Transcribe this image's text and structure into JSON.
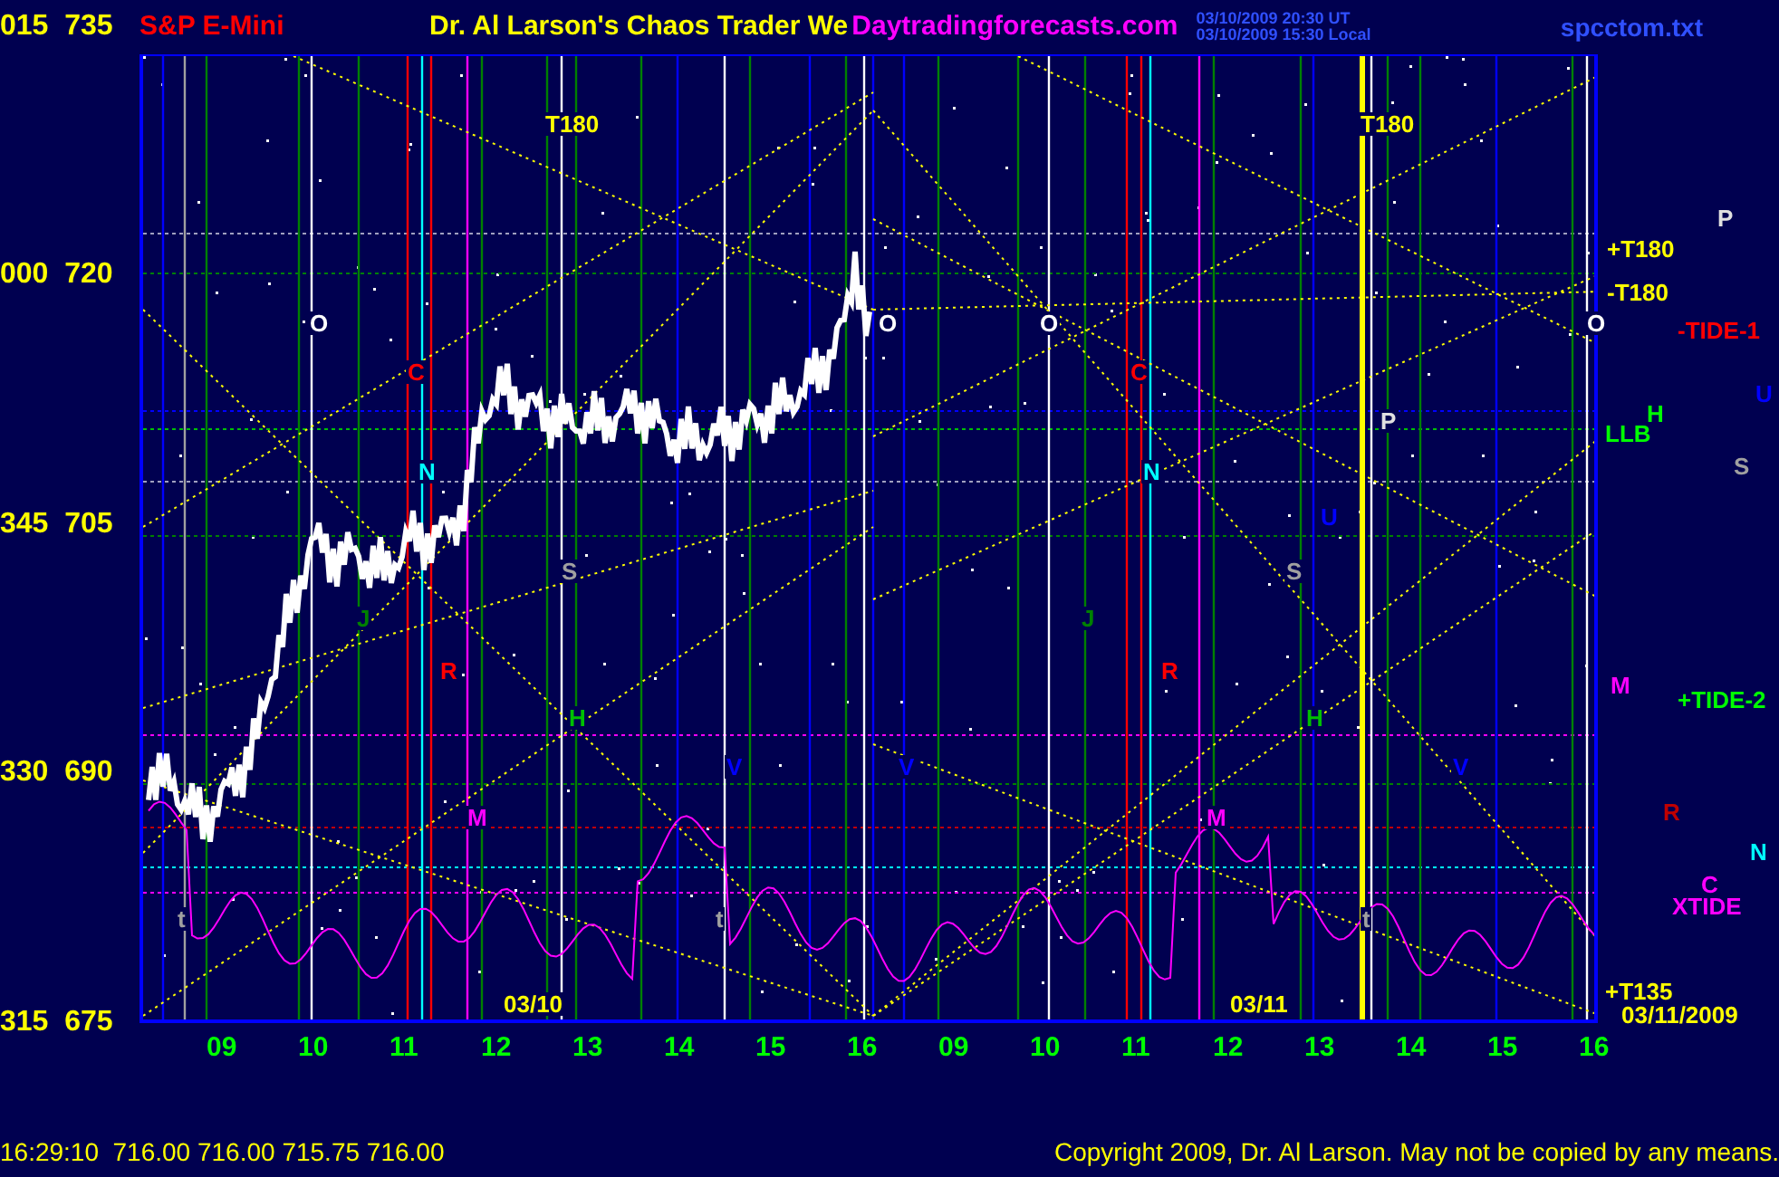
{
  "header": {
    "axis_label": "015  735",
    "symbol": "S&P E-Mini",
    "title": "Dr. Al Larson's Chaos Trader We",
    "site": "Daytradingforecasts.com",
    "times": [
      "03/10/2009 20:30 UT",
      "03/10/2009 15:30 Local"
    ],
    "file": "spcctom.txt"
  },
  "y_axis": [
    "000  720",
    "345  705",
    "330  690",
    "315  675"
  ],
  "x_axis": [
    "09",
    "10",
    "11",
    "12",
    "13",
    "14",
    "15",
    "16",
    "09",
    "10",
    "11",
    "12",
    "13",
    "14",
    "15",
    "16"
  ],
  "chart_labels": [
    {
      "text": "T180",
      "color": "#ffff00"
    },
    {
      "text": "T180",
      "color": "#ffff00"
    },
    {
      "text": "O",
      "color": "#ffffff"
    },
    {
      "text": "O",
      "color": "#ffffff"
    },
    {
      "text": "O",
      "color": "#ffffff"
    },
    {
      "text": "O",
      "color": "#ffffff"
    },
    {
      "text": "C",
      "color": "#ff0000"
    },
    {
      "text": "C",
      "color": "#ff0000"
    },
    {
      "text": "P",
      "color": "#e0e0e0"
    },
    {
      "text": "N",
      "color": "#00ffff"
    },
    {
      "text": "N",
      "color": "#00ffff"
    },
    {
      "text": "U",
      "color": "#0000ff"
    },
    {
      "text": "S",
      "color": "#a0a0a0"
    },
    {
      "text": "S",
      "color": "#a0a0a0"
    },
    {
      "text": "J",
      "color": "#008000"
    },
    {
      "text": "J",
      "color": "#008000"
    },
    {
      "text": "R",
      "color": "#ff0000"
    },
    {
      "text": "R",
      "color": "#ff0000"
    },
    {
      "text": "H",
      "color": "#00c000"
    },
    {
      "text": "H",
      "color": "#00c000"
    },
    {
      "text": "V",
      "color": "#0000ff"
    },
    {
      "text": "V",
      "color": "#0000ff"
    },
    {
      "text": "V",
      "color": "#0000ff"
    },
    {
      "text": "M",
      "color": "#ff00ff"
    },
    {
      "text": "M",
      "color": "#ff00ff"
    },
    {
      "text": "t",
      "color": "#a0a0a0"
    },
    {
      "text": "t",
      "color": "#a0a0a0"
    },
    {
      "text": "t",
      "color": "#a0a0a0"
    },
    {
      "text": "03/10",
      "color": "#ffff00"
    },
    {
      "text": "03/11",
      "color": "#ffff00"
    }
  ],
  "side_labels": [
    {
      "text": "P",
      "color": "#e0e0e0"
    },
    {
      "text": "+T180",
      "color": "#ffff00"
    },
    {
      "text": "-T180",
      "color": "#ffff00"
    },
    {
      "text": "-TIDE-1",
      "color": "#ff0000"
    },
    {
      "text": "U",
      "color": "#0000ff"
    },
    {
      "text": "H",
      "color": "#00ff00"
    },
    {
      "text": "LLB",
      "color": "#00ff00"
    },
    {
      "text": "S",
      "color": "#a0a0a0"
    },
    {
      "text": "M",
      "color": "#ff00ff"
    },
    {
      "text": "+TIDE-2",
      "color": "#00ff00"
    },
    {
      "text": "R",
      "color": "#c00000"
    },
    {
      "text": "N",
      "color": "#00ffff"
    },
    {
      "text": "C",
      "color": "#ff00ff"
    },
    {
      "text": "XTIDE",
      "color": "#ff00ff"
    },
    {
      "text": "+T135",
      "color": "#ffff00"
    },
    {
      "text": "03/11/2009",
      "color": "#ffff00"
    }
  ],
  "status": {
    "quote": "16:29:10  716.00 716.00 715.75 716.00",
    "copyright": "Copyright 2009, Dr. Al Larson. May not be copied by any means."
  }
}
